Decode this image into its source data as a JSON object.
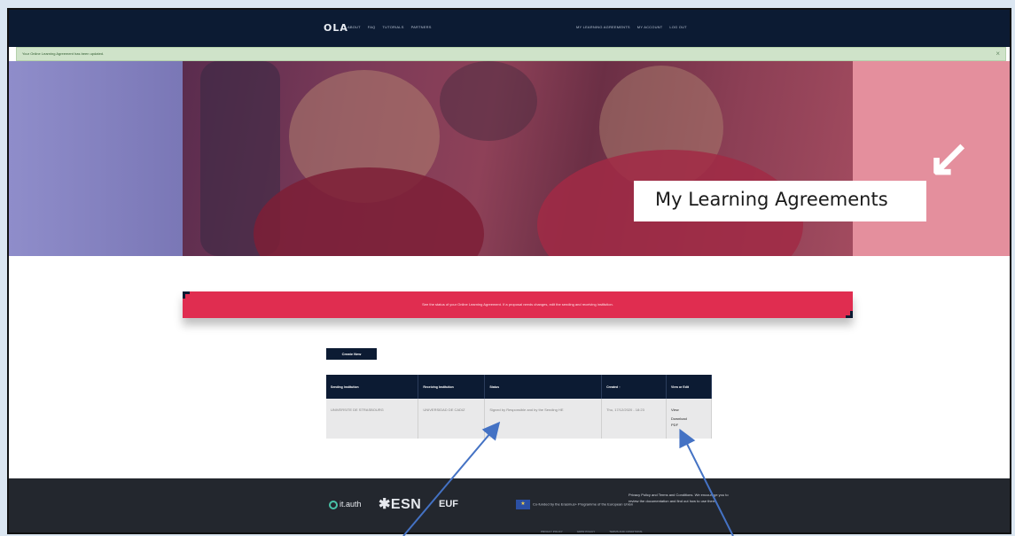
{
  "header": {
    "logo": "OLA",
    "nav_left": [
      "ABOUT",
      "FAQ",
      "TUTORIALS",
      "PARTNERS"
    ],
    "nav_right": [
      "MY LEARNING AGREEMENTS",
      "MY ACCOUNT",
      "LOG OUT"
    ]
  },
  "message": {
    "text": "Your Online Learning Agreement has been updated.",
    "close": "×"
  },
  "hero": {
    "title": "My Learning Agreements",
    "arrow": "↙"
  },
  "info_banner": {
    "text": "See the status of your Online Learning Agreement. If a proposal needs changes, edit the sending and receiving institution."
  },
  "create_button": "Create New",
  "table": {
    "headers": [
      "Sending Institution",
      "Receiving Institution",
      "Status",
      "Created ↑",
      "View or Edit"
    ],
    "rows": [
      {
        "sending": "UNIVERSITE DE STRASBOURG",
        "receiving": "UNIVERSIDAD DE CADIZ",
        "status": "Signed by Responsible and by the Sending HE",
        "created": "Thu, 17/12/2020 - 18:23",
        "view": "View",
        "download": "Download PDF"
      }
    ]
  },
  "footer": {
    "logos": [
      "it.auth",
      "ESN",
      "EUF",
      "Co-funded by the Erasmus+ Programme of the European Union"
    ],
    "note": "Privacy Policy and Terms and Conditions. We encourage you to review the documentation and find out how to use them.",
    "links": [
      "PRIVACY POLICY",
      "GDPR POLICY",
      "TERMS AND CONDITIONS"
    ]
  },
  "colors": {
    "navy": "#0c1b33",
    "banner_red": "#e02d50",
    "hero_pink": "#e48f9d",
    "hero_purple": "#8f8dca",
    "arrow_blue": "#4472c4"
  },
  "icons": {
    "close": "close-icon",
    "hero_arrow": "arrow-down-left-icon"
  }
}
